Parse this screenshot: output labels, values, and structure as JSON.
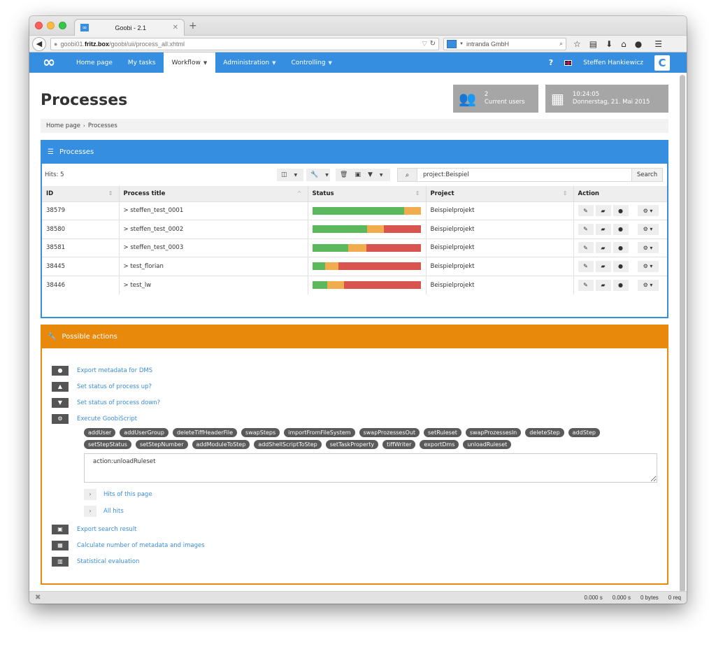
{
  "browser": {
    "tab_title": "Goobi - 2.1",
    "tab_favicon": "∞",
    "url_host_pre": "goobi01.",
    "url_host_bold": "fritz.box",
    "url_path": "/goobi/uii/process_all.xhtml",
    "search_engine_text": "intranda GmbH",
    "icons": [
      "star-icon",
      "reading-list-icon",
      "download-icon",
      "home-icon",
      "chat-icon",
      "menu-icon"
    ]
  },
  "nav": {
    "logo": "∞",
    "items": [
      {
        "label": "Home page",
        "active": false,
        "dropdown": false
      },
      {
        "label": "My tasks",
        "active": false,
        "dropdown": false
      },
      {
        "label": "Workflow",
        "active": true,
        "dropdown": true
      },
      {
        "label": "Administration",
        "active": false,
        "dropdown": true
      },
      {
        "label": "Controlling",
        "active": false,
        "dropdown": true
      }
    ],
    "help": "?",
    "user_name": "Steffen Hankiewicz"
  },
  "header": {
    "title": "Processes",
    "current_users_count": "2",
    "current_users_label": "Current users",
    "time": "10:24:05",
    "date": "Donnerstag, 21. Mai 2015"
  },
  "breadcrumb": [
    "Home page",
    "Processes"
  ],
  "processes_panel": {
    "title": "Processes",
    "hits": "Hits: 5",
    "search_value": "project:Beispiel",
    "search_button": "Search",
    "columns": [
      "ID",
      "Process title",
      "Status",
      "Project",
      "Action"
    ],
    "rows": [
      {
        "id": "38579",
        "title": "> steffen_test_0001",
        "status": {
          "done": 84,
          "in_progress": 16,
          "open": 0
        },
        "project": "Beispielprojekt"
      },
      {
        "id": "38580",
        "title": "> steffen_test_0002",
        "status": {
          "done": 50,
          "in_progress": 16,
          "open": 34
        },
        "project": "Beispielprojekt"
      },
      {
        "id": "38581",
        "title": "> steffen_test_0003",
        "status": {
          "done": 33,
          "in_progress": 17,
          "open": 50
        },
        "project": "Beispielprojekt"
      },
      {
        "id": "38445",
        "title": "> test_florian",
        "status": {
          "done": 12,
          "in_progress": 12,
          "open": 76
        },
        "project": "Beispielprojekt"
      },
      {
        "id": "38446",
        "title": "> test_lw",
        "status": {
          "done": 14,
          "in_progress": 15,
          "open": 71
        },
        "project": "Beispielprojekt"
      }
    ]
  },
  "actions_panel": {
    "title": "Possible actions",
    "top_actions": [
      {
        "icon": "globe-icon",
        "glyph": "●",
        "label": "Export metadata for DMS"
      },
      {
        "icon": "caret-square-up-icon",
        "glyph": "▲",
        "label": "Set status of process up?"
      },
      {
        "icon": "caret-square-down-icon",
        "glyph": "▼",
        "label": "Set status of process down?"
      },
      {
        "icon": "cogs-icon",
        "glyph": "⚙",
        "label": "Execute GoobiScript"
      }
    ],
    "goobiscript_commands": [
      "addUser",
      "addUserGroup",
      "deleteTiffHeaderFile",
      "swapSteps",
      "importFromFileSystem",
      "swapProzessesOut",
      "setRuleset",
      "swapProzessesIn",
      "deleteStep",
      "addStep",
      "setStepStatus",
      "setStepNumber",
      "addModuleToStep",
      "addShellScriptToStep",
      "setTaskProperty",
      "tiffWriter",
      "exportDms",
      "unloadRuleset"
    ],
    "script_value": "action:unloadRuleset",
    "run_targets": [
      "Hits of this page",
      "All hits"
    ],
    "bottom_actions": [
      {
        "icon": "save-icon",
        "glyph": "▣",
        "label": "Export search result"
      },
      {
        "icon": "table-icon",
        "glyph": "▦",
        "label": "Calculate number of metadata and images"
      },
      {
        "icon": "bar-chart-icon",
        "glyph": "▥",
        "label": "Statistical evaluation"
      }
    ]
  },
  "statusbar": {
    "values": [
      "0.000 s",
      "0.000 s",
      "0 bytes",
      "0 req"
    ]
  },
  "colors": {
    "primary": "#368ee0",
    "warning": "#e8890c",
    "done": "#5cb85c",
    "in_progress": "#f0ad4e",
    "open": "#d9534f"
  }
}
